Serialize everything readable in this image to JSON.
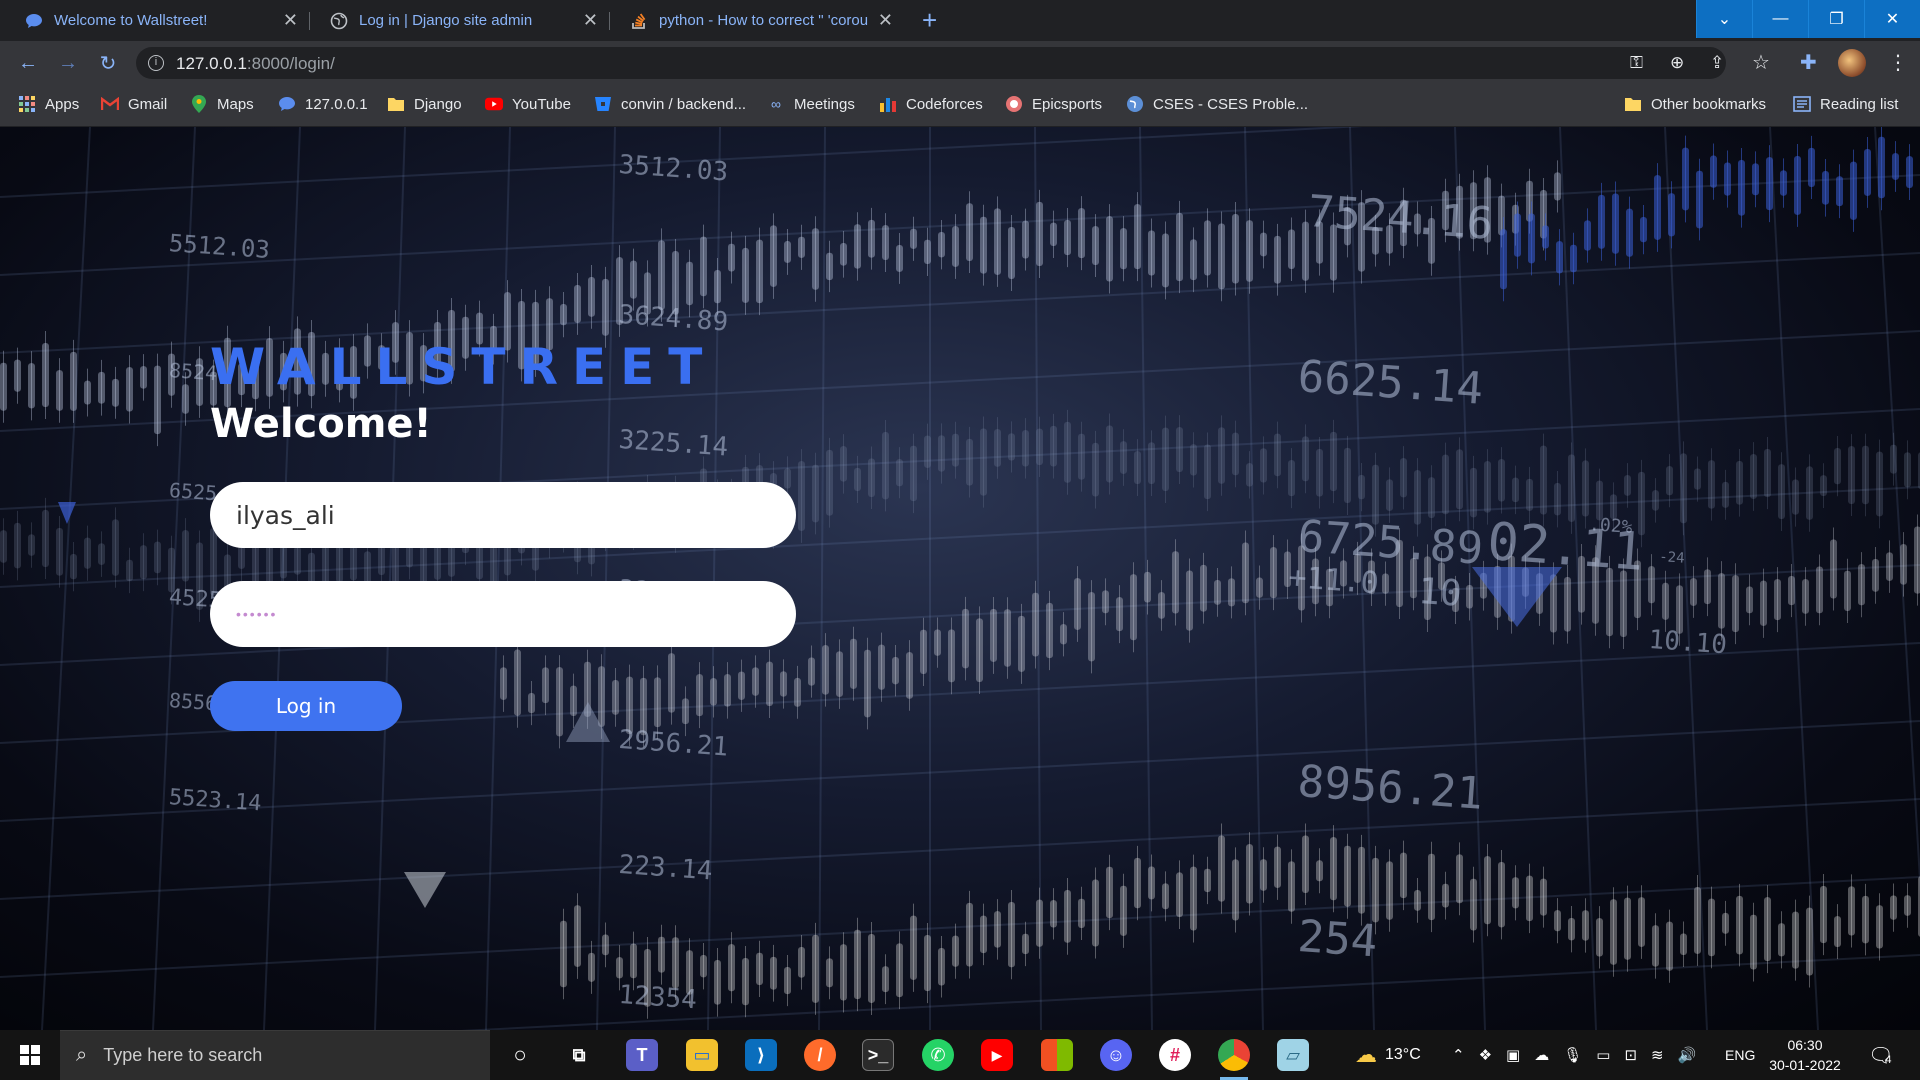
{
  "tabs": [
    {
      "title": "Welcome to Wallstreet!",
      "icon": "chat-bubble-icon"
    },
    {
      "title": "Log in | Django site admin",
      "icon": "globe-icon"
    },
    {
      "title": "python - How to correct \" 'corou",
      "icon": "stackoverflow-icon"
    }
  ],
  "address": {
    "host": "127.0.0.1",
    "rest": ":8000/login/"
  },
  "bookmarks": [
    {
      "label": "Apps",
      "icon": "apps-grid-icon"
    },
    {
      "label": "Gmail",
      "icon": "gmail-icon"
    },
    {
      "label": "Maps",
      "icon": "maps-pin-icon"
    },
    {
      "label": "127.0.0.1",
      "icon": "chat-bubble-icon"
    },
    {
      "label": "Django",
      "icon": "folder-icon"
    },
    {
      "label": "YouTube",
      "icon": "youtube-icon"
    },
    {
      "label": "convin / backend...",
      "icon": "bitbucket-icon"
    },
    {
      "label": "Meetings",
      "icon": "meetings-icon"
    },
    {
      "label": "Codeforces",
      "icon": "codeforces-icon"
    },
    {
      "label": "Epicsports",
      "icon": "epicsports-icon"
    },
    {
      "label": "CSES - CSES Proble...",
      "icon": "globe-icon"
    }
  ],
  "bookmarks_right": [
    {
      "label": "Other bookmarks",
      "icon": "folder-icon"
    },
    {
      "label": "Reading list",
      "icon": "reading-list-icon"
    }
  ],
  "page": {
    "brand": "WALLSTREET",
    "heading": "Welcome!",
    "username_value": "ilyas_ali",
    "password_mask": "••••••",
    "login_label": "Log in",
    "background_numbers": [
      "3512.03",
      "7524.16",
      "5512.03",
      "3624.89",
      "6625.14",
      "3225.14",
      "6725.89",
      "02.11",
      "+11.0",
      "10",
      "10.10",
      ".02%",
      "-24",
      "3225.69",
      "4525.89",
      "2956.21",
      "8956.21",
      "5523.14",
      "8556.21",
      "223.14",
      "254",
      "12354",
      "6525.14",
      "8524"
    ]
  },
  "taskbar": {
    "search_placeholder": "Type here to search",
    "weather": "13°C",
    "language": "ENG",
    "time": "06:30",
    "date": "30-01-2022",
    "notification_count": "4"
  },
  "colors": {
    "brand": "#3a6ff1",
    "button": "#3f73f0",
    "tab_text": "#8ab4f8"
  }
}
